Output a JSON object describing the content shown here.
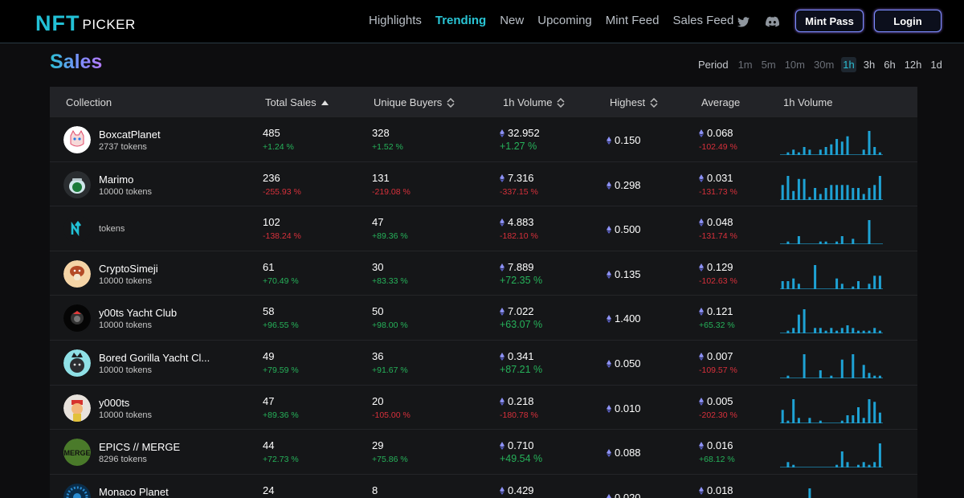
{
  "brand": {
    "logo_main": "NFT",
    "logo_sub": "PICKER"
  },
  "nav": {
    "links": [
      {
        "label": "Highlights",
        "active": false
      },
      {
        "label": "Trending",
        "active": true
      },
      {
        "label": "New",
        "active": false
      },
      {
        "label": "Upcoming",
        "active": false
      },
      {
        "label": "Mint Feed",
        "active": false
      },
      {
        "label": "Sales Feed",
        "active": false
      }
    ],
    "social_icons": [
      "twitter-icon",
      "discord-icon"
    ],
    "mint_pass_label": "Mint Pass",
    "login_label": "Login"
  },
  "page": {
    "title": "Sales"
  },
  "period": {
    "label": "Period",
    "options": [
      "1m",
      "5m",
      "10m",
      "30m",
      "1h",
      "3h",
      "6h",
      "12h",
      "1d"
    ],
    "selected": "1h"
  },
  "table": {
    "columns": [
      "Collection",
      "Total Sales",
      "Unique Buyers",
      "1h Volume",
      "Highest",
      "Average",
      "1h Volume"
    ],
    "sort_icons": [
      "sort-asc-icon",
      "sort-icon",
      "sort-icon",
      "sort-icon"
    ],
    "rows": [
      {
        "name": "BoxcatPlanet",
        "tokens": "2737 tokens",
        "sales": "485",
        "sales_chg": "+1.24 %",
        "buyers": "328",
        "buyers_chg": "+1.52 %",
        "volume": "32.952",
        "volume_chg": "+1.27 %",
        "highest": "0.150",
        "average": "0.068",
        "average_chg": "-102.49 %",
        "spark": [
          0,
          1,
          2,
          1,
          3,
          2,
          0,
          2,
          3,
          4,
          6,
          5,
          7,
          0,
          0,
          2,
          9,
          3,
          1
        ]
      },
      {
        "name": "Marimo",
        "tokens": "10000 tokens",
        "sales": "236",
        "sales_chg": "-255.93 %",
        "buyers": "131",
        "buyers_chg": "-219.08 %",
        "volume": "7.316",
        "volume_chg": "-337.15 %",
        "highest": "0.298",
        "average": "0.031",
        "average_chg": "-131.73 %",
        "spark": [
          5,
          8,
          3,
          7,
          7,
          1,
          4,
          2,
          4,
          5,
          5,
          5,
          5,
          4,
          4,
          2,
          4,
          5,
          8
        ]
      },
      {
        "name": "",
        "tokens": "tokens",
        "sales": "102",
        "sales_chg": "-138.24 %",
        "buyers": "47",
        "buyers_chg": "+89.36 %",
        "volume": "4.883",
        "volume_chg": "-182.10 %",
        "highest": "0.500",
        "average": "0.048",
        "average_chg": "-131.74 %",
        "spark": [
          0,
          1,
          0,
          3,
          0,
          0,
          0,
          1,
          1,
          0,
          1,
          3,
          0,
          2,
          0,
          0,
          9,
          0,
          0
        ]
      },
      {
        "name": "CryptoSimeji",
        "tokens": "10000 tokens",
        "sales": "61",
        "sales_chg": "+70.49 %",
        "buyers": "30",
        "buyers_chg": "+83.33 %",
        "volume": "7.889",
        "volume_chg": "+72.35 %",
        "highest": "0.135",
        "average": "0.129",
        "average_chg": "-102.63 %",
        "spark": [
          3,
          3,
          4,
          2,
          0,
          0,
          9,
          0,
          0,
          0,
          4,
          2,
          0,
          1,
          3,
          0,
          2,
          5,
          5
        ]
      },
      {
        "name": "y00ts Yacht Club",
        "tokens": "10000 tokens",
        "sales": "58",
        "sales_chg": "+96.55 %",
        "buyers": "50",
        "buyers_chg": "+98.00 %",
        "volume": "7.022",
        "volume_chg": "+63.07 %",
        "highest": "1.400",
        "average": "0.121",
        "average_chg": "+65.32 %",
        "spark": [
          0,
          1,
          2,
          7,
          9,
          0,
          2,
          2,
          1,
          2,
          1,
          2,
          3,
          2,
          1,
          1,
          1,
          2,
          1
        ]
      },
      {
        "name": "Bored Gorilla Yacht Cl...",
        "tokens": "10000 tokens",
        "sales": "49",
        "sales_chg": "+79.59 %",
        "buyers": "36",
        "buyers_chg": "+91.67 %",
        "volume": "0.341",
        "volume_chg": "+87.21 %",
        "highest": "0.050",
        "average": "0.007",
        "average_chg": "-109.57 %",
        "spark": [
          0,
          1,
          0,
          0,
          9,
          0,
          0,
          3,
          0,
          1,
          0,
          7,
          0,
          9,
          0,
          5,
          2,
          1,
          1
        ]
      },
      {
        "name": "y000ts",
        "tokens": "10000 tokens",
        "sales": "47",
        "sales_chg": "+89.36 %",
        "buyers": "20",
        "buyers_chg": "-105.00 %",
        "volume": "0.218",
        "volume_chg": "-180.78 %",
        "highest": "0.010",
        "average": "0.005",
        "average_chg": "-202.30 %",
        "spark": [
          5,
          1,
          9,
          2,
          0,
          2,
          0,
          1,
          0,
          0,
          0,
          1,
          3,
          3,
          6,
          2,
          9,
          8,
          4
        ]
      },
      {
        "name": "EPICS // MERGE",
        "tokens": "8296 tokens",
        "sales": "44",
        "sales_chg": "+72.73 %",
        "buyers": "29",
        "buyers_chg": "+75.86 %",
        "volume": "0.710",
        "volume_chg": "+49.54 %",
        "highest": "0.088",
        "average": "0.016",
        "average_chg": "+68.12 %",
        "spark": [
          0,
          2,
          1,
          0,
          0,
          0,
          0,
          0,
          0,
          0,
          1,
          6,
          2,
          0,
          1,
          2,
          1,
          2,
          9
        ]
      },
      {
        "name": "Monaco Planet",
        "tokens": "",
        "sales": "24",
        "sales_chg": "",
        "buyers": "8",
        "buyers_chg": "",
        "volume": "0.429",
        "volume_chg": "",
        "highest": "0.020",
        "average": "0.018",
        "average_chg": "",
        "spark": [
          0,
          0,
          0,
          0,
          0,
          9,
          0,
          0,
          0,
          0,
          0,
          0,
          0,
          0,
          0,
          0,
          0,
          0,
          0
        ]
      }
    ]
  },
  "colors": {
    "accent": "#29c4d4",
    "positive": "#26b25a",
    "negative": "#d7303b",
    "bar": "#1ea2d4"
  }
}
